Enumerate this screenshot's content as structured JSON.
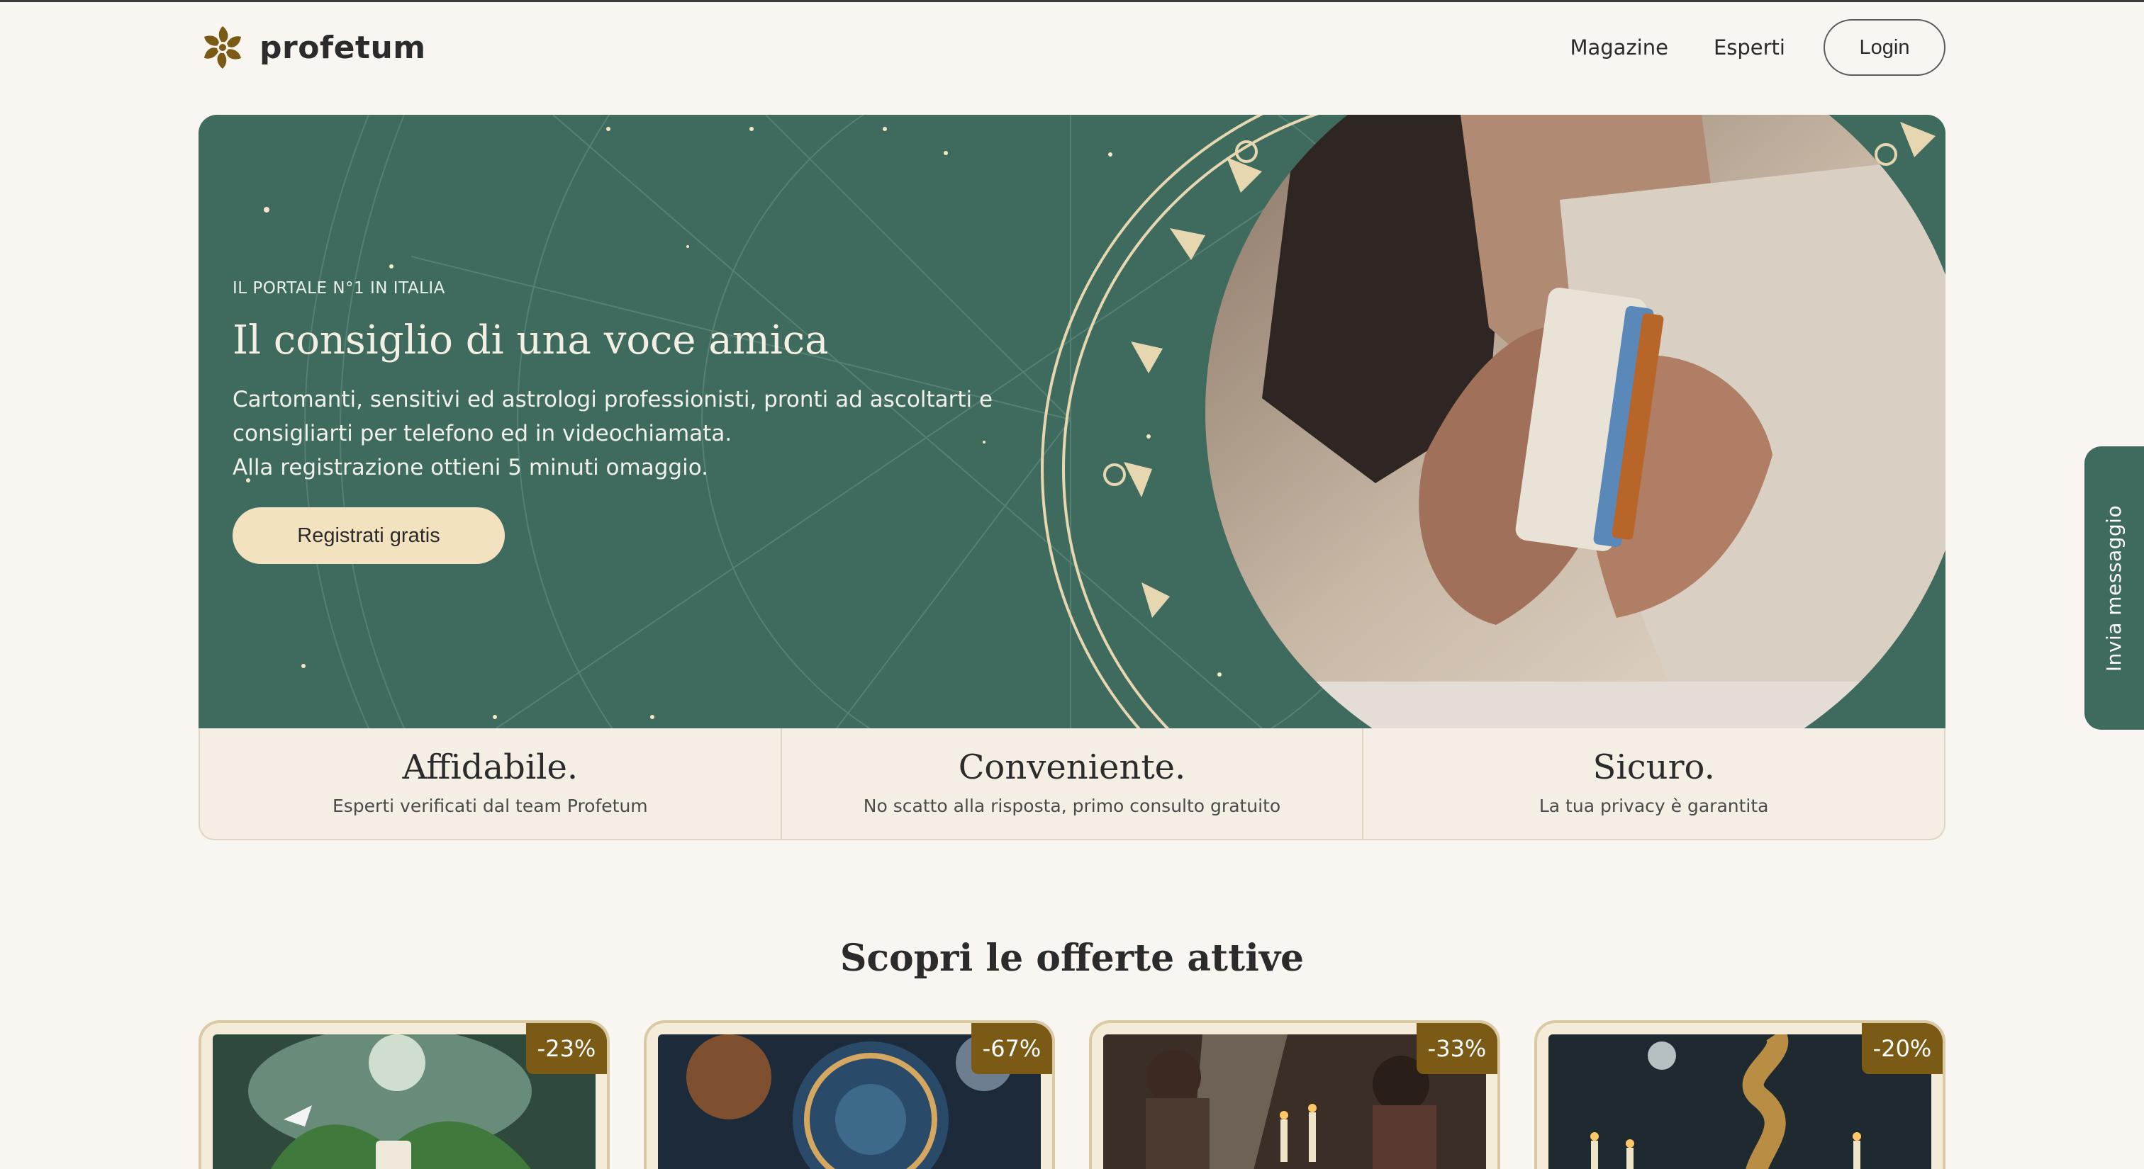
{
  "brand": {
    "name": "profetum"
  },
  "nav": {
    "items": [
      "Magazine",
      "Esperti"
    ],
    "login_label": "Login"
  },
  "hero": {
    "eyebrow": "IL PORTALE N°1 IN ITALIA",
    "title": "Il consiglio di una voce amica",
    "desc_lines": [
      "Cartomanti, sensitivi ed astrologi professionisti, pronti ad ascoltarti e",
      "consigliarti per telefono ed in videochiamata.",
      "Alla registrazione ottieni 5 minuti omaggio."
    ],
    "cta_label": "Registrati gratis"
  },
  "features": [
    {
      "title": "Affidabile.",
      "subtitle": "Esperti verificati dal team Profetum"
    },
    {
      "title": "Conveniente.",
      "subtitle": "No scatto alla risposta, primo consulto gratuito"
    },
    {
      "title": "Sicuro.",
      "subtitle": "La tua privacy è garantita"
    }
  ],
  "offers": {
    "title": "Scopri le offerte attive",
    "cards": [
      {
        "discount": "-23%"
      },
      {
        "discount": "-67%"
      },
      {
        "discount": "-33%"
      },
      {
        "discount": "-20%"
      }
    ]
  },
  "side_tab": {
    "label": "Invia messaggio"
  },
  "colors": {
    "page_bg": "#f9f6f1",
    "hero_green": "#3e6b5e",
    "cta_cream": "#f3e2c0",
    "gold": "#d9c38a",
    "badge_brown": "#7a5a14"
  }
}
